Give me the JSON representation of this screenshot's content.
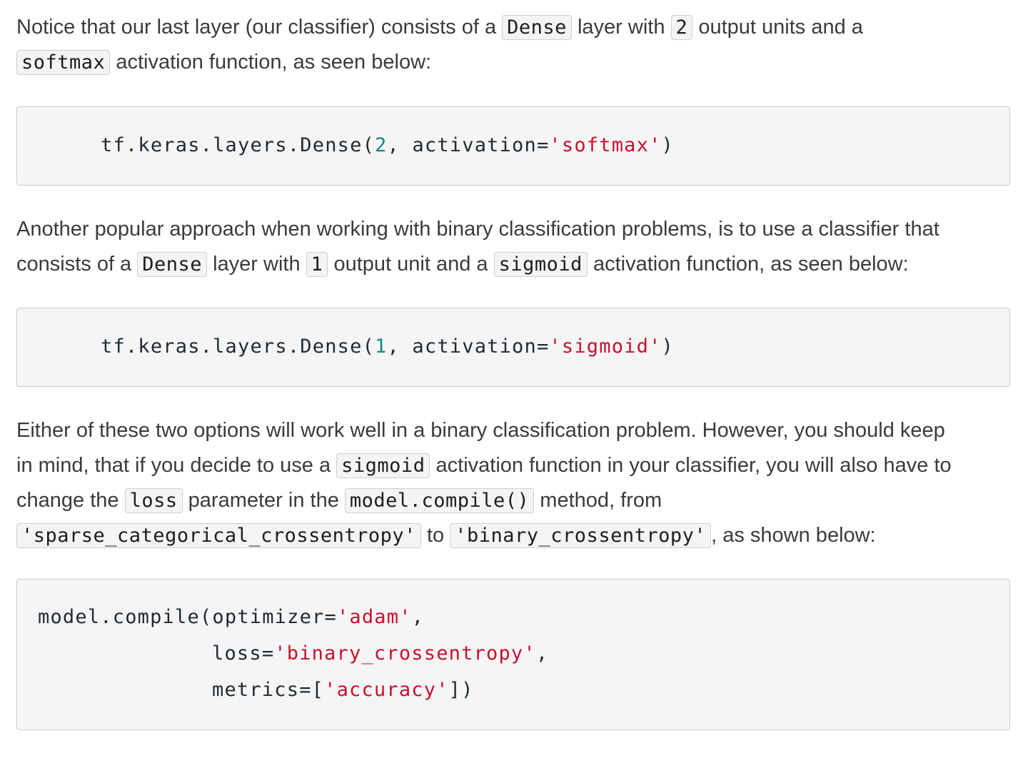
{
  "para1": {
    "t1": "Notice that our last layer (our classifier) consists of a ",
    "c1": "Dense",
    "t2": " layer with ",
    "c2": "2",
    "t3": " output units and a",
    "c3": "softmax",
    "t4": " activation function, as seen below:"
  },
  "code1": {
    "pre": "tf.keras.layers.Dense(",
    "num": "2",
    "mid": ", activation=",
    "str": "'softmax'",
    "post": ")"
  },
  "para2": {
    "line1": "Another popular approach when working with binary classification problems, is to use a classifier that",
    "t1": "consists of a ",
    "c1": "Dense",
    "t2": " layer with ",
    "c2": "1",
    "t3": " output unit and a ",
    "c3": "sigmoid",
    "t4": " activation function, as seen below:"
  },
  "code2": {
    "pre": "tf.keras.layers.Dense(",
    "num": "1",
    "mid": ", activation=",
    "str": "'sigmoid'",
    "post": ")"
  },
  "para3": {
    "line1": "Either of these two options will work well in a binary classification problem. However, you should keep",
    "t1": "in mind, that if you decide to use a ",
    "c1": "sigmoid",
    "t2": " activation function in your classifier, you will also have to",
    "t3": "change the ",
    "c2": "loss",
    "t4": " parameter in the ",
    "c3": "model.compile()",
    "t5": " method, from",
    "c4": "'sparse_categorical_crossentropy'",
    "t6": " to ",
    "c5": "'binary_crossentropy'",
    "t7": ", as shown below:"
  },
  "code3": {
    "l1_pre": "model.compile(optimizer=",
    "l1_str": "'adam'",
    "l1_post": ",",
    "l2_pre": "loss=",
    "l2_str": "'binary_crossentropy'",
    "l2_post": ",",
    "l3_pre": "metrics=[",
    "l3_str": "'accuracy'",
    "l3_post": "])"
  }
}
